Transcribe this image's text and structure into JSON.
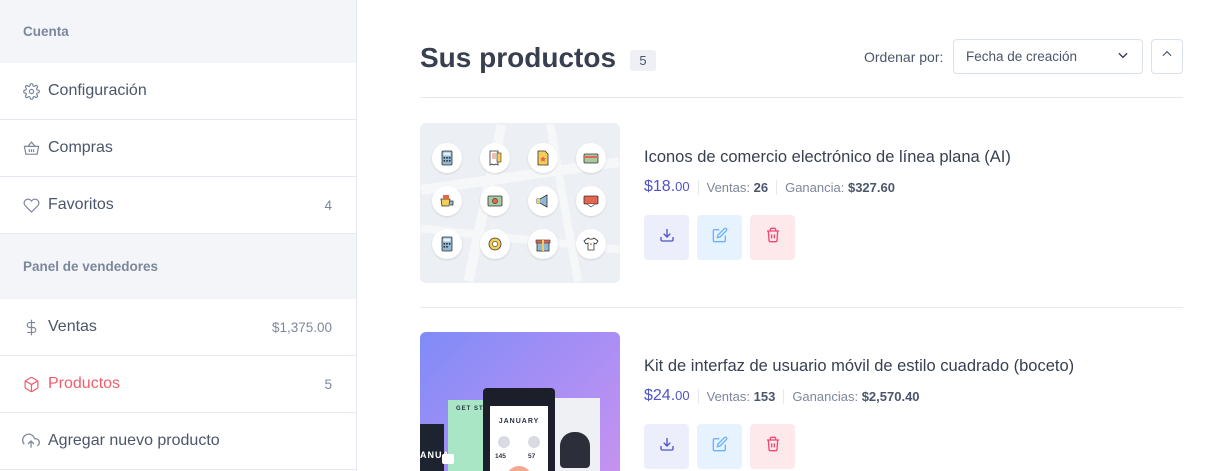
{
  "sidebar": {
    "account_heading": "Cuenta",
    "account_items": [
      {
        "label": "Configuración",
        "icon": "gear-icon"
      },
      {
        "label": "Compras",
        "icon": "basket-icon"
      },
      {
        "label": "Favoritos",
        "icon": "heart-icon",
        "value": "4"
      }
    ],
    "seller_heading": "Panel de vendedores",
    "seller_items": [
      {
        "label": "Ventas",
        "icon": "dollar-icon",
        "value": "$1,375.00"
      },
      {
        "label": "Productos",
        "icon": "package-icon",
        "value": "5",
        "active": true
      },
      {
        "label": "Agregar nuevo producto",
        "icon": "cloud-upload-icon"
      }
    ]
  },
  "header": {
    "title": "Sus productos",
    "count": "5",
    "sort_label": "Ordenar por:",
    "sort_value": "Fecha de creación"
  },
  "products": [
    {
      "title": "Iconos de comercio electrónico de línea plana (AI)",
      "price_main": "$18.",
      "price_cents": "00",
      "sales_label": "Ventas:",
      "sales": "26",
      "earnings_label": "Ganancia:",
      "earnings": "$327.60"
    },
    {
      "title": "Kit de interfaz de usuario móvil de estilo cuadrado (boceto)",
      "price_main": "$24.",
      "price_cents": "00",
      "sales_label": "Ventas:",
      "sales": "153",
      "earnings_label": "Ganancias:",
      "earnings": "$2,570.40"
    }
  ],
  "thumb2_text": {
    "month": "JANUARY",
    "stat_a": "145",
    "stat_b": "57",
    "get_started": "GET STA",
    "side_word": "ANUA"
  },
  "colors": {
    "accent": "#4e54c8",
    "active": "#f05d6c",
    "danger": "#f34770",
    "info": "#69b3fe"
  }
}
